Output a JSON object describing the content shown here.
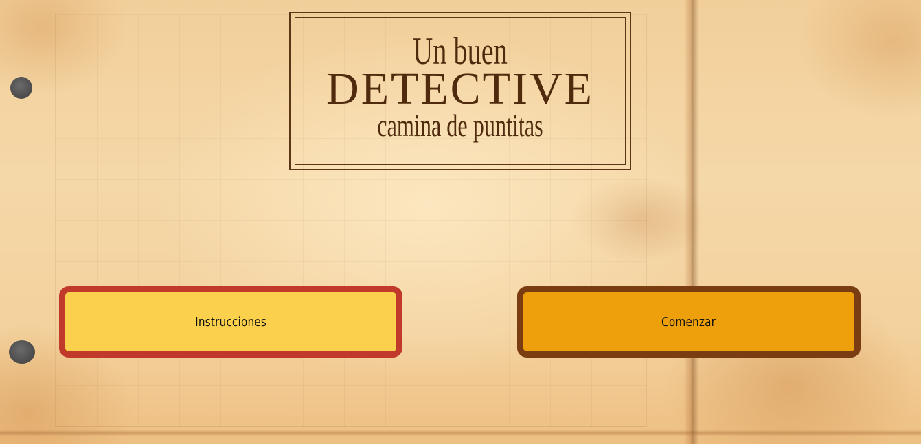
{
  "title": {
    "line1": "Un buen",
    "line2": "DETECTIVE",
    "line3": "camina de puntitas"
  },
  "buttons": {
    "instructions_label": "Instrucciones",
    "start_label": "Comenzar"
  },
  "colors": {
    "title_text": "#4f2a0c",
    "instructions_fill": "#fbd04d",
    "instructions_border": "#c0392b",
    "start_fill": "#eda00c",
    "start_border": "#7a3d12"
  }
}
